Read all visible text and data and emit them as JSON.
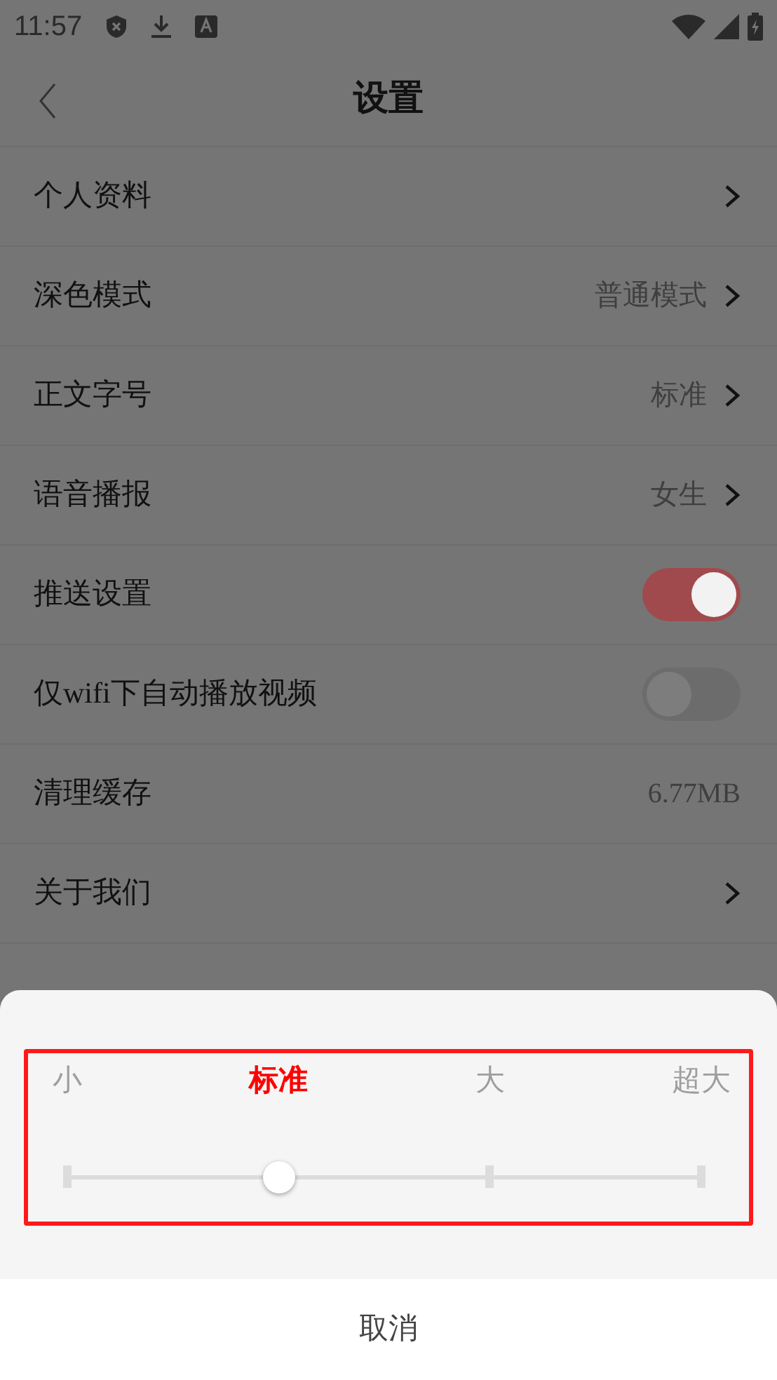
{
  "status_bar": {
    "time": "11:57"
  },
  "header": {
    "title": "设置"
  },
  "rows": [
    {
      "kind": "link",
      "label": "个人资料"
    },
    {
      "kind": "link",
      "label": "深色模式",
      "value": "普通模式"
    },
    {
      "kind": "link",
      "label": "正文字号",
      "value": "标准"
    },
    {
      "kind": "link",
      "label": "语音播报",
      "value": "女生"
    },
    {
      "kind": "toggle",
      "label": "推送设置",
      "on": true
    },
    {
      "kind": "toggle",
      "label": "仅wifi下自动播放视频",
      "on": false
    },
    {
      "kind": "value",
      "label": "清理缓存",
      "value": "6.77MB"
    },
    {
      "kind": "link",
      "label": "关于我们"
    }
  ],
  "font_size_sheet": {
    "highlighted": true,
    "options": [
      {
        "label": "小",
        "selected": false
      },
      {
        "label": "标准",
        "selected": true
      },
      {
        "label": "大",
        "selected": false
      },
      {
        "label": "超大",
        "selected": false
      }
    ],
    "cancel": "取消"
  }
}
